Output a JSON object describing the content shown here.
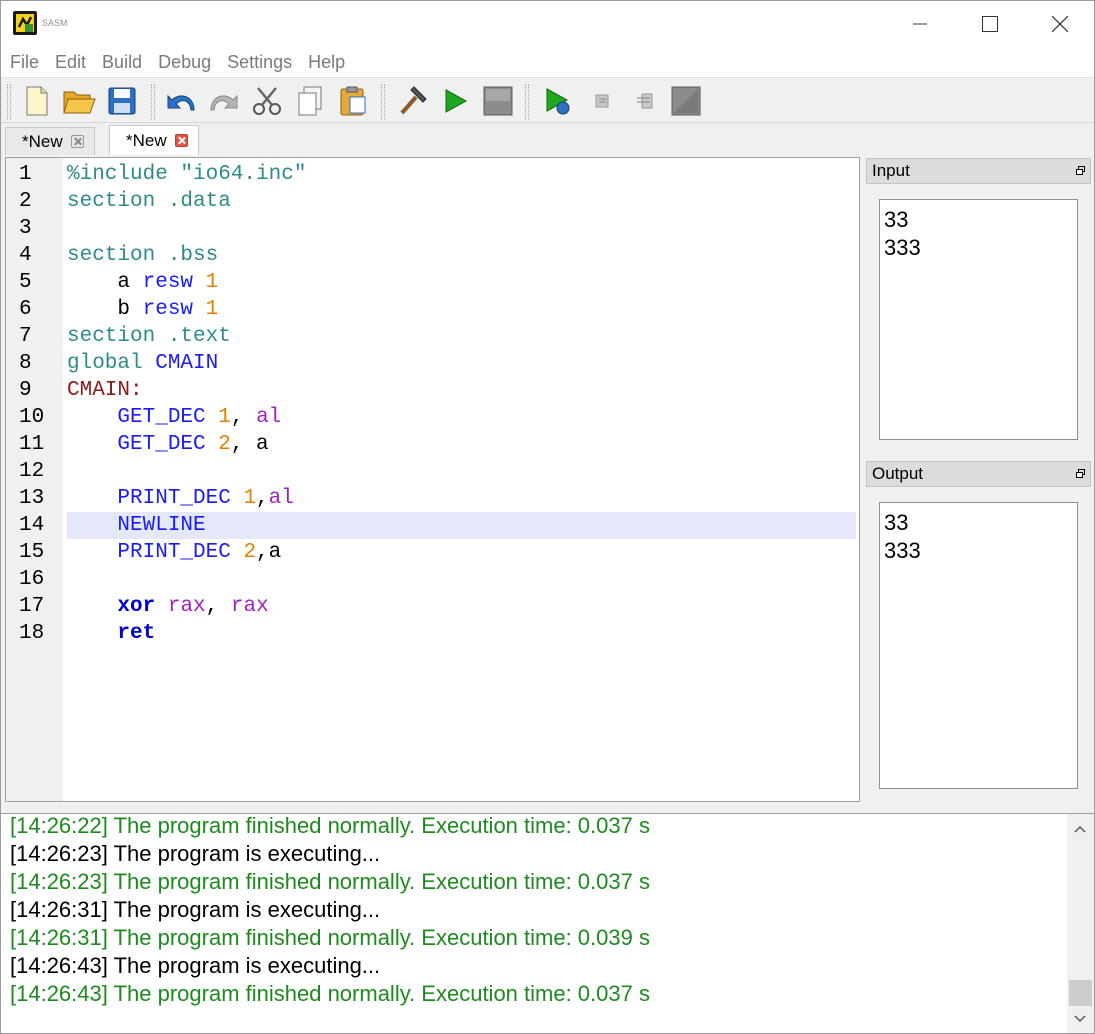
{
  "window": {
    "title": "SASM"
  },
  "menu": [
    "File",
    "Edit",
    "Build",
    "Debug",
    "Settings",
    "Help"
  ],
  "tabs": [
    {
      "label": "*New",
      "active": false
    },
    {
      "label": "*New",
      "active": true
    }
  ],
  "editor": {
    "current_line": 14,
    "lines": [
      {
        "n": "1",
        "parts": [
          {
            "t": "%include \"io64.inc\"",
            "c": "c-dir"
          }
        ]
      },
      {
        "n": "2",
        "parts": [
          {
            "t": "section .data",
            "c": "c-dir"
          }
        ]
      },
      {
        "n": "3",
        "parts": []
      },
      {
        "n": "4",
        "parts": [
          {
            "t": "section .bss",
            "c": "c-dir"
          }
        ]
      },
      {
        "n": "5",
        "parts": [
          {
            "t": "    a ",
            "c": "c-plain"
          },
          {
            "t": "resw",
            "c": "c-macro"
          },
          {
            "t": " ",
            "c": "c-plain"
          },
          {
            "t": "1",
            "c": "c-num"
          }
        ]
      },
      {
        "n": "6",
        "parts": [
          {
            "t": "    b ",
            "c": "c-plain"
          },
          {
            "t": "resw",
            "c": "c-macro"
          },
          {
            "t": " ",
            "c": "c-plain"
          },
          {
            "t": "1",
            "c": "c-num"
          }
        ]
      },
      {
        "n": "7",
        "parts": [
          {
            "t": "section .text",
            "c": "c-dir"
          }
        ]
      },
      {
        "n": "8",
        "parts": [
          {
            "t": "global ",
            "c": "c-dir"
          },
          {
            "t": "CMAIN",
            "c": "c-macro"
          }
        ]
      },
      {
        "n": "9",
        "parts": [
          {
            "t": "CMAIN:",
            "c": "c-label"
          }
        ]
      },
      {
        "n": "10",
        "parts": [
          {
            "t": "    GET_DEC ",
            "c": "c-macro"
          },
          {
            "t": "1",
            "c": "c-num"
          },
          {
            "t": ", ",
            "c": "c-plain"
          },
          {
            "t": "al",
            "c": "c-reg"
          }
        ]
      },
      {
        "n": "11",
        "parts": [
          {
            "t": "    GET_DEC ",
            "c": "c-macro"
          },
          {
            "t": "2",
            "c": "c-num"
          },
          {
            "t": ", a",
            "c": "c-plain"
          }
        ]
      },
      {
        "n": "12",
        "parts": []
      },
      {
        "n": "13",
        "parts": [
          {
            "t": "    PRINT_DEC ",
            "c": "c-macro"
          },
          {
            "t": "1",
            "c": "c-num"
          },
          {
            "t": ",",
            "c": "c-plain"
          },
          {
            "t": "al",
            "c": "c-reg"
          }
        ]
      },
      {
        "n": "14",
        "parts": [
          {
            "t": "    NEWLINE",
            "c": "c-macro"
          }
        ]
      },
      {
        "n": "15",
        "parts": [
          {
            "t": "    PRINT_DEC ",
            "c": "c-macro"
          },
          {
            "t": "2",
            "c": "c-num"
          },
          {
            "t": ",a",
            "c": "c-plain"
          }
        ]
      },
      {
        "n": "16",
        "parts": []
      },
      {
        "n": "17",
        "parts": [
          {
            "t": "    ",
            "c": "c-plain"
          },
          {
            "t": "xor",
            "c": "c-kw"
          },
          {
            "t": " ",
            "c": "c-plain"
          },
          {
            "t": "rax",
            "c": "c-reg"
          },
          {
            "t": ", ",
            "c": "c-plain"
          },
          {
            "t": "rax",
            "c": "c-reg"
          }
        ]
      },
      {
        "n": "18",
        "parts": [
          {
            "t": "    ",
            "c": "c-plain"
          },
          {
            "t": "ret",
            "c": "c-kw"
          }
        ]
      }
    ]
  },
  "input_panel": {
    "title": "Input",
    "lines": [
      "33",
      "333"
    ]
  },
  "output_panel": {
    "title": "Output",
    "lines": [
      "33",
      "333"
    ]
  },
  "log": [
    {
      "text": "[14:26:22] The program finished normally. Execution time: 0.037 s",
      "kind": "ok"
    },
    {
      "text": "[14:26:23] The program is executing...",
      "kind": "run"
    },
    {
      "text": "[14:26:23] The program finished normally. Execution time: 0.037 s",
      "kind": "ok"
    },
    {
      "text": "[14:26:31] The program is executing...",
      "kind": "run"
    },
    {
      "text": "[14:26:31] The program finished normally. Execution time: 0.039 s",
      "kind": "ok"
    },
    {
      "text": "[14:26:43] The program is executing...",
      "kind": "run"
    },
    {
      "text": "[14:26:43] The program finished normally. Execution time: 0.037 s",
      "kind": "ok"
    }
  ],
  "colors": {
    "log_ok": "#1e8a1e",
    "current_line_bg": "#e5e7fb",
    "directive": "#2e8b8b",
    "macro": "#1a1aff",
    "number": "#e08000",
    "register": "#a020c0",
    "label": "#8b1a1a",
    "keyword": "#0000cc"
  }
}
